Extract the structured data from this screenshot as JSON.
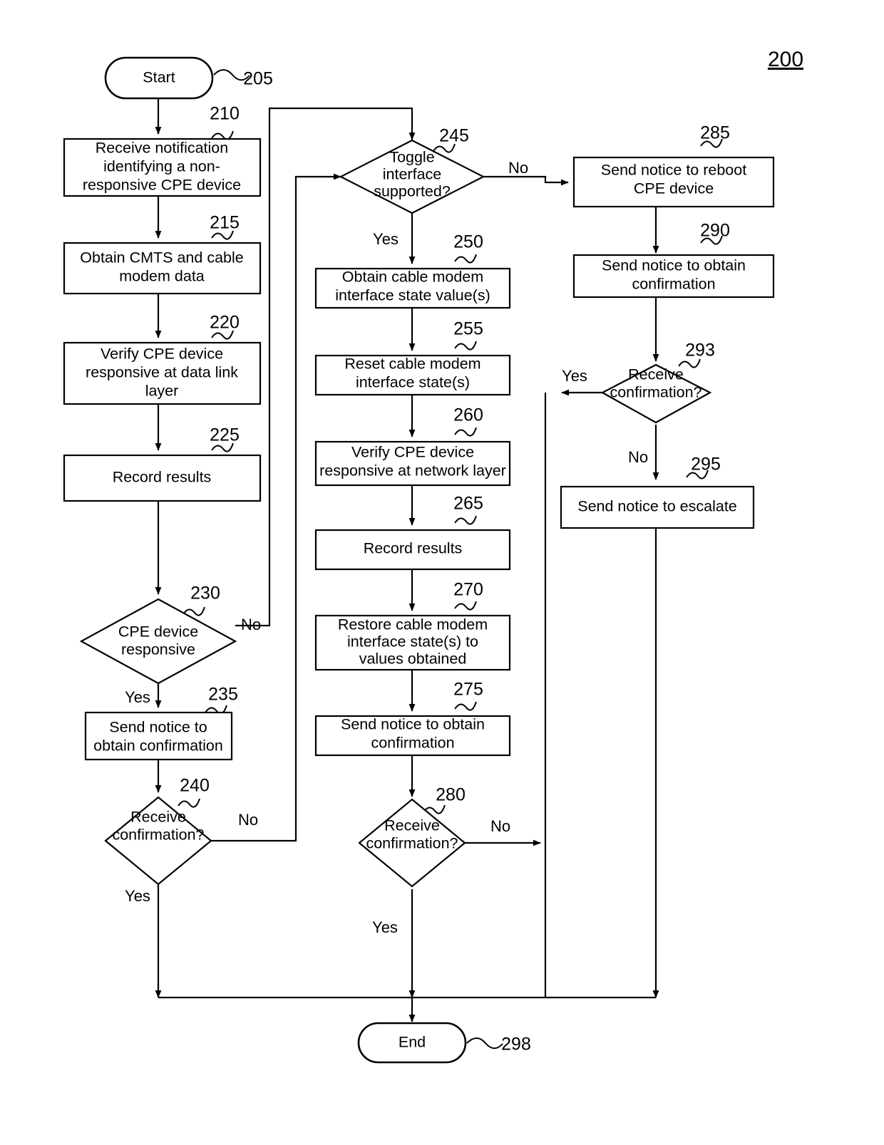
{
  "figure": {
    "number": "200",
    "title_label": "200"
  },
  "nodes": {
    "start": {
      "ref": "205",
      "label": "Start",
      "type": "terminal"
    },
    "n210": {
      "ref": "210",
      "type": "process",
      "lines": [
        "Receive notification",
        "identifying a non-",
        "responsive CPE device"
      ]
    },
    "n215": {
      "ref": "215",
      "type": "process",
      "lines": [
        "Obtain CMTS and cable",
        "modem data"
      ]
    },
    "n220": {
      "ref": "220",
      "type": "process",
      "lines": [
        "Verify CPE device",
        "responsive at data link",
        "layer"
      ]
    },
    "n225": {
      "ref": "225",
      "type": "process",
      "lines": [
        "Record results"
      ]
    },
    "n230": {
      "ref": "230",
      "type": "decision",
      "lines": [
        "CPE device",
        "responsive"
      ]
    },
    "n235": {
      "ref": "235",
      "type": "process",
      "lines": [
        "Send notice to",
        "obtain confirmation"
      ]
    },
    "n240": {
      "ref": "240",
      "type": "decision",
      "lines": [
        "Receive",
        "confirmation?"
      ]
    },
    "n245": {
      "ref": "245",
      "type": "decision",
      "lines": [
        "Toggle",
        "interface",
        "supported?"
      ]
    },
    "n250": {
      "ref": "250",
      "type": "process",
      "lines": [
        "Obtain cable modem",
        "interface state value(s)"
      ]
    },
    "n255": {
      "ref": "255",
      "type": "process",
      "lines": [
        "Reset cable modem",
        "interface state(s)"
      ]
    },
    "n260": {
      "ref": "260",
      "type": "process",
      "lines": [
        "Verify CPE device",
        "responsive at network layer"
      ]
    },
    "n265": {
      "ref": "265",
      "type": "process",
      "lines": [
        "Record results"
      ]
    },
    "n270": {
      "ref": "270",
      "type": "process",
      "lines": [
        "Restore cable modem",
        "interface state(s) to",
        "values obtained"
      ]
    },
    "n275": {
      "ref": "275",
      "type": "process",
      "lines": [
        "Send notice to obtain",
        "confirmation"
      ]
    },
    "n280": {
      "ref": "280",
      "type": "decision",
      "lines": [
        "Receive",
        "confirmation?"
      ]
    },
    "n285": {
      "ref": "285",
      "type": "process",
      "lines": [
        "Send notice to reboot",
        "CPE device"
      ]
    },
    "n290": {
      "ref": "290",
      "type": "process",
      "lines": [
        "Send notice to obtain",
        "confirmation"
      ]
    },
    "n293": {
      "ref": "293",
      "type": "decision",
      "lines": [
        "Receive",
        "confirmation?"
      ]
    },
    "n295": {
      "ref": "295",
      "type": "process",
      "lines": [
        "Send notice to escalate"
      ]
    },
    "end": {
      "ref": "298",
      "label": "End",
      "type": "terminal"
    }
  },
  "edge_labels": {
    "e230_no": "No",
    "e230_yes": "Yes",
    "e240_no": "No",
    "e240_yes": "Yes",
    "e245_no": "No",
    "e245_yes": "Yes",
    "e280_no": "No",
    "e280_yes": "Yes",
    "e293_no": "No",
    "e293_yes": "Yes"
  }
}
